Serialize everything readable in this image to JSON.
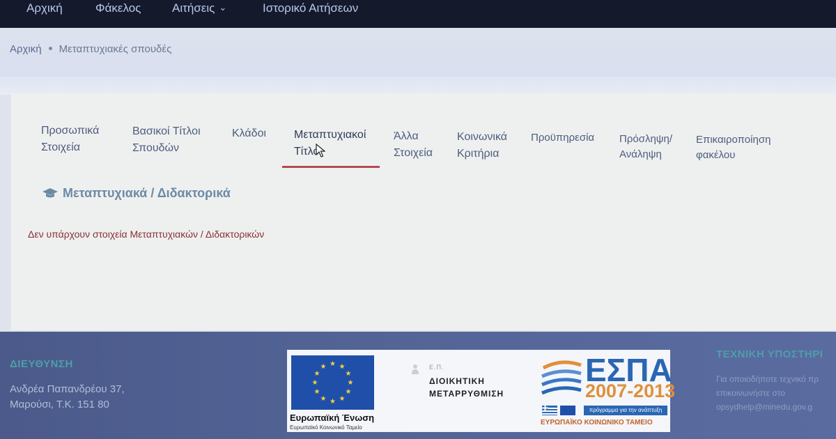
{
  "nav": {
    "items": [
      {
        "label": "Αρχική"
      },
      {
        "label": "Φάκελος"
      },
      {
        "label": "Αιτήσεις"
      },
      {
        "label": "Ιστορικό Αιτήσεων"
      }
    ]
  },
  "breadcrumb": {
    "home": "Αρχική",
    "current": "Μεταπτυχιακές σπουδές"
  },
  "tabs": [
    {
      "line1": "Προσωπικά",
      "line2": "Στοιχεία"
    },
    {
      "line1": "Βασικοί Τίτλοι",
      "line2": "Σπουδών"
    },
    {
      "line1": "Κλάδοι",
      "line2": ""
    },
    {
      "line1": "Μεταπτυχιακοί",
      "line2": "Τίτλοι"
    },
    {
      "line1": "Άλλα",
      "line2": "Στοιχεία"
    },
    {
      "line1": "Κοινωνικά",
      "line2": "Κριτήρια"
    },
    {
      "line1": "Προϋπηρεσία",
      "line2": ""
    },
    {
      "line1": "Πρόσληψη/",
      "line2": "Ανάληψη"
    },
    {
      "line1": "Επικαιροποίηση",
      "line2": "φακέλου"
    }
  ],
  "section": {
    "title": "Μεταπτυχιακά / Διδακτορικά",
    "empty_message": "Δεν υπάρχουν στοιχεία Μεταπτυχιακών / Διδακτορικών"
  },
  "footer": {
    "address_title": "ΔΙΕΥΘΥΝΣΗ",
    "address_line1": "Ανδρέα Παπανδρέου 37,",
    "address_line2": "Μαρούσι, Τ.Κ. 151 80",
    "support_title": "ΤΕΧΝΙΚΗ ΥΠΟΣΤΗΡΙ",
    "support_line1": "Για οποιοδήποτε τεχνικό πρ",
    "support_line2": "επικοινωνήστε στο",
    "support_email": "opsydhelp@minedu.gov.g",
    "logos": {
      "eu_name": "Ευρωπαϊκή Ένωση",
      "eu_sub": "Ευρωπαϊκό Κοινωνικό Ταμείο",
      "ep_label": "Ε.Π.",
      "ep_line1": "ΔΙΟΙΚΗΤΙΚΗ",
      "ep_line2": "ΜΕΤΑΡΡΥΘΜΙΣΗ",
      "espa_title": "ΕΣΠΑ",
      "espa_years": "2007-2013",
      "espa_program": "πρόγραμμα για την ανάπτυξη",
      "espa_fund": "ΕΥΡΩΠΑΪΚΟ ΚΟΙΝΩΝΙΚΟ ΤΑΜΕΙΟ"
    }
  },
  "colors": {
    "nav_bg": "#141a2c",
    "active_tab_underline": "#b64a52",
    "section_title": "#6d8aa5",
    "empty_message": "#8b2f33",
    "footer_bg": "#55679a"
  }
}
